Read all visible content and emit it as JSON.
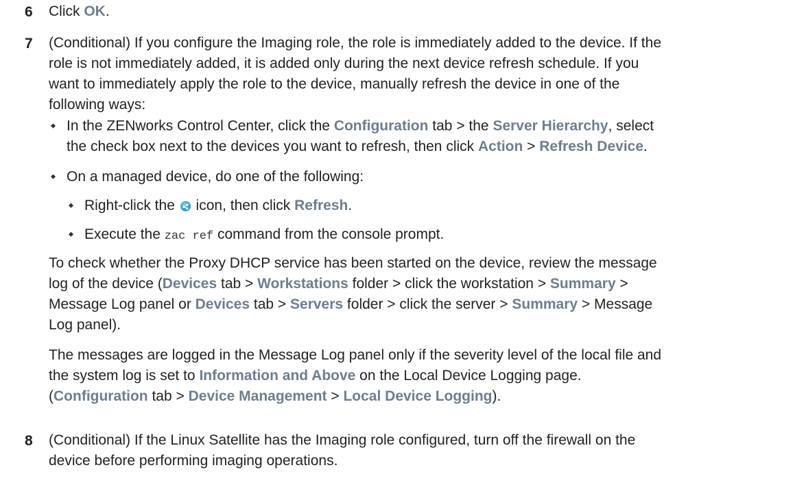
{
  "step6": {
    "num": "6",
    "pre": "Click ",
    "ok": "OK",
    "post": "."
  },
  "step7": {
    "num": "7",
    "line1": "(Conditional) If you configure the Imaging role, the role is immediately added to the device. If the",
    "line2": "role is not immediately added, it is added only during the next device refresh schedule. If you",
    "line3": "want to immediately apply the role to the device, manually refresh the device in one of the",
    "line4": "following ways:",
    "bullet1": {
      "t1": "In the ZENworks Control Center, click the ",
      "configuration": "Configuration",
      "t2": " tab > the ",
      "server_hierarchy": "Server Hierarchy",
      "t3": ", select",
      "t4": "the check box next to the devices you want to refresh, then click ",
      "action": "Action",
      "t5": " > ",
      "refresh_device": "Refresh Device",
      "t6": "."
    },
    "bullet2": {
      "text": "On a managed device, do one of the following:",
      "sub1": {
        "t1": "Right-click the ",
        "t2": " icon, then click ",
        "refresh": "Refresh",
        "t3": "."
      },
      "sub2": {
        "t1": "Execute the ",
        "code": "zac ref",
        "t2": " command from the console prompt."
      }
    },
    "para1": {
      "t1": "To check whether the Proxy DHCP service has been started on the device, review the message",
      "t2": "log of the device (",
      "devices": "Devices",
      "t3": " tab > ",
      "workstations": "Workstations",
      "t4": " folder > click the workstation > ",
      "summary": "Summary",
      "t5": " >",
      "t6": "Message Log panel or ",
      "devices2": "Devices",
      "t7": " tab > ",
      "servers": "Servers",
      "t8": " folder > click the server > ",
      "summary2": "Summary",
      "t9": " > Message",
      "t10": "Log panel)."
    },
    "para2": {
      "t1": "The messages are logged in the Message Log panel only if the severity level of the local file and",
      "t2": "the system log is set to ",
      "info": "Information and Above",
      "t3": " on the Local Device Logging page.",
      "t4": "(",
      "configuration": "Configuration",
      "t5": " tab > ",
      "device_management": "Device Management",
      "t6": " > ",
      "local_device_logging": "Local Device Logging",
      "t7": ")."
    }
  },
  "step8": {
    "num": "8",
    "line1": "(Conditional) If the Linux Satellite has the Imaging role configured, turn off the firewall on the",
    "line2": "device before performing imaging operations."
  },
  "colors": {
    "ui_term": "#6d7e8f",
    "text": "#222222",
    "icon": "#1e8fd6"
  },
  "icons": [
    "zenworks-icon",
    "bullet-diamond"
  ]
}
